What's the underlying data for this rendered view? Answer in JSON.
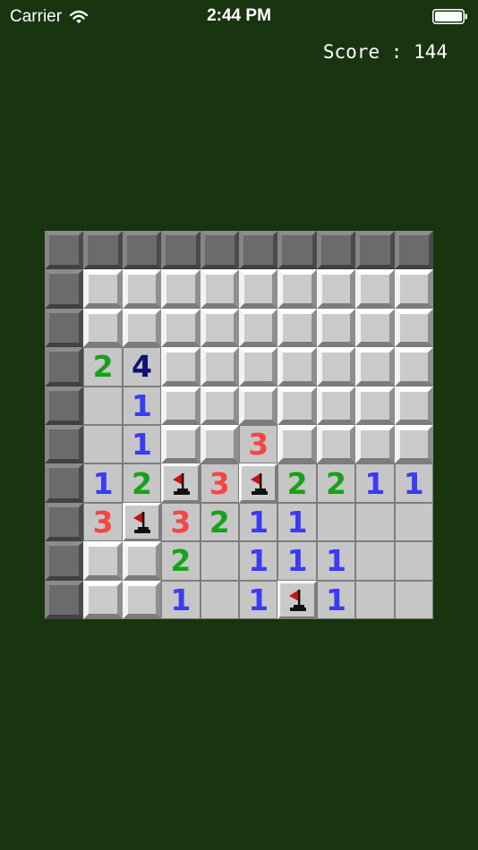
{
  "status_bar": {
    "carrier": "Carrier",
    "time": "2:44 PM"
  },
  "score": {
    "label": "Score",
    "separator": ":",
    "value": "144"
  },
  "colors": {
    "background": "#183510",
    "number_1": "#3b3bf5",
    "number_2": "#17a11b",
    "number_3": "#f54545",
    "number_4": "#101075",
    "flag": "#cc1111"
  },
  "board": {
    "size": 10,
    "legend": "H=header tile, C=covered tile, E=revealed empty, F=flag, digit=revealed number",
    "rows": [
      [
        "H",
        "H",
        "H",
        "H",
        "H",
        "H",
        "H",
        "H",
        "H",
        "H"
      ],
      [
        "H",
        "C",
        "C",
        "C",
        "C",
        "C",
        "C",
        "C",
        "C",
        "C"
      ],
      [
        "H",
        "C",
        "C",
        "C",
        "C",
        "C",
        "C",
        "C",
        "C",
        "C"
      ],
      [
        "H",
        "2",
        "4",
        "C",
        "C",
        "C",
        "C",
        "C",
        "C",
        "C"
      ],
      [
        "H",
        "E",
        "1",
        "C",
        "C",
        "C",
        "C",
        "C",
        "C",
        "C"
      ],
      [
        "H",
        "E",
        "1",
        "C",
        "C",
        "3",
        "C",
        "C",
        "C",
        "C"
      ],
      [
        "H",
        "1",
        "2",
        "F",
        "3",
        "F",
        "2",
        "2",
        "1",
        "1"
      ],
      [
        "H",
        "3",
        "F",
        "3",
        "2",
        "1",
        "1",
        "E",
        "E",
        "E"
      ],
      [
        "H",
        "C",
        "C",
        "2",
        "E",
        "1",
        "1",
        "1",
        "E",
        "E"
      ],
      [
        "H",
        "C",
        "C",
        "1",
        "E",
        "1",
        "F",
        "1",
        "E",
        "E"
      ]
    ]
  }
}
